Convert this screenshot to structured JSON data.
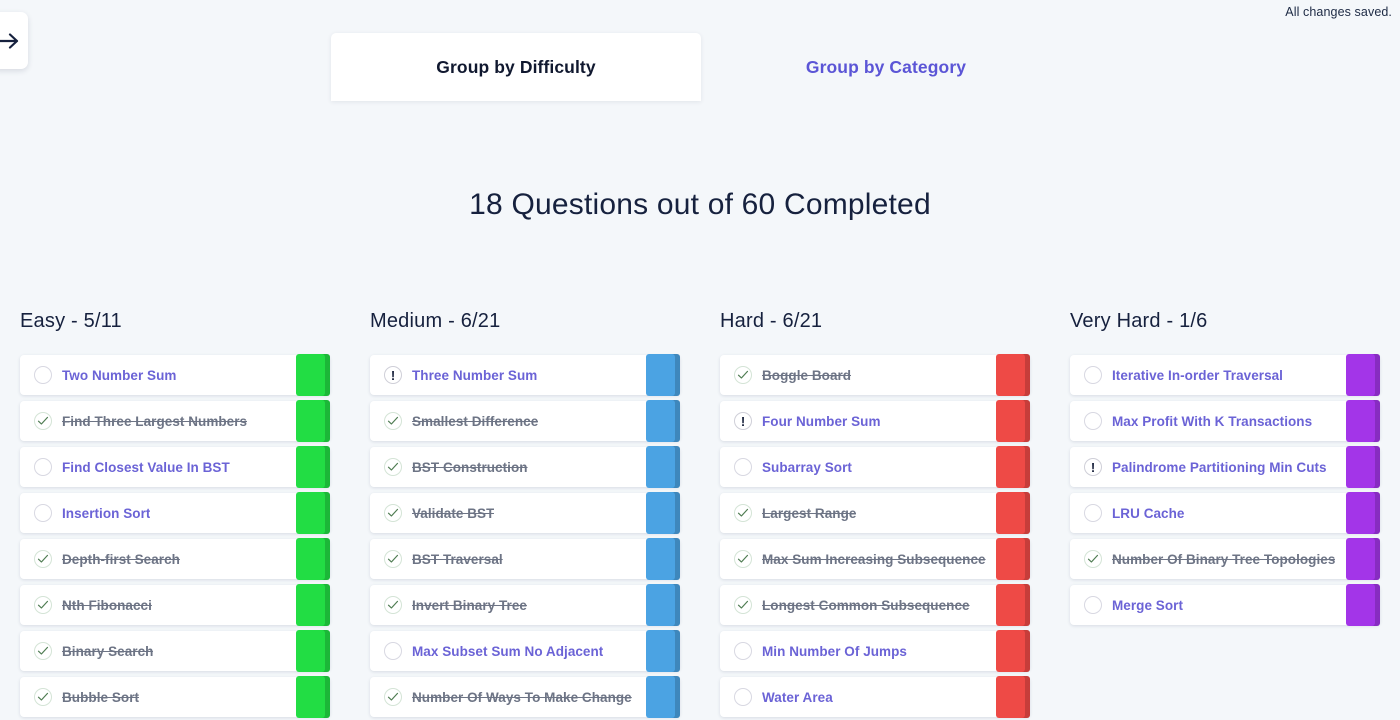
{
  "header": {
    "save_status": "All changes saved.",
    "sidebar_toggle_icon": "arrow-right-icon"
  },
  "tabs": [
    {
      "label": "Group by Difficulty",
      "active": true
    },
    {
      "label": "Group by Category",
      "active": false
    }
  ],
  "progress": {
    "heading": "18 Questions out of 60 Completed",
    "completed": 18,
    "total": 60
  },
  "colors": {
    "easy": "#22dd44",
    "medium": "#4ba3e3",
    "hard": "#ee4a46",
    "very_hard": "#a335e8",
    "link": "#6b63d6",
    "done_text": "#6d7485",
    "page_bg": "#f4f7fa",
    "card_bg": "#ffffff"
  },
  "columns": [
    {
      "title": "Easy - 5/11",
      "name": "Easy",
      "completed": 5,
      "total": 11,
      "color": "#22dd44",
      "questions": [
        {
          "label": "Two Number Sum",
          "status": "todo"
        },
        {
          "label": "Find Three Largest Numbers",
          "status": "done"
        },
        {
          "label": "Find Closest Value In BST",
          "status": "todo"
        },
        {
          "label": "Insertion Sort",
          "status": "todo"
        },
        {
          "label": "Depth-first Search",
          "status": "done"
        },
        {
          "label": "Nth Fibonacci",
          "status": "done"
        },
        {
          "label": "Binary Search",
          "status": "done"
        },
        {
          "label": "Bubble Sort",
          "status": "done"
        }
      ]
    },
    {
      "title": "Medium - 6/21",
      "name": "Medium",
      "completed": 6,
      "total": 21,
      "color": "#4ba3e3",
      "questions": [
        {
          "label": "Three Number Sum",
          "status": "flag"
        },
        {
          "label": "Smallest Difference",
          "status": "done"
        },
        {
          "label": "BST Construction",
          "status": "done"
        },
        {
          "label": "Validate BST",
          "status": "done"
        },
        {
          "label": "BST Traversal",
          "status": "done"
        },
        {
          "label": "Invert Binary Tree",
          "status": "done"
        },
        {
          "label": "Max Subset Sum No Adjacent",
          "status": "todo"
        },
        {
          "label": "Number Of Ways To Make Change",
          "status": "done"
        }
      ]
    },
    {
      "title": "Hard - 6/21",
      "name": "Hard",
      "completed": 6,
      "total": 21,
      "color": "#ee4a46",
      "questions": [
        {
          "label": "Boggle Board",
          "status": "done"
        },
        {
          "label": "Four Number Sum",
          "status": "flag"
        },
        {
          "label": "Subarray Sort",
          "status": "todo"
        },
        {
          "label": "Largest Range",
          "status": "done"
        },
        {
          "label": "Max Sum Increasing Subsequence",
          "status": "done"
        },
        {
          "label": "Longest Common Subsequence",
          "status": "done"
        },
        {
          "label": "Min Number Of Jumps",
          "status": "todo"
        },
        {
          "label": "Water Area",
          "status": "todo"
        }
      ]
    },
    {
      "title": "Very Hard - 1/6",
      "name": "Very Hard",
      "completed": 1,
      "total": 6,
      "color": "#a335e8",
      "questions": [
        {
          "label": "Iterative In-order Traversal",
          "status": "todo"
        },
        {
          "label": "Max Profit With K Transactions",
          "status": "todo"
        },
        {
          "label": "Palindrome Partitioning Min Cuts",
          "status": "flag"
        },
        {
          "label": "LRU Cache",
          "status": "todo"
        },
        {
          "label": "Number Of Binary Tree Topologies",
          "status": "done"
        },
        {
          "label": "Merge Sort",
          "status": "todo"
        }
      ]
    }
  ]
}
